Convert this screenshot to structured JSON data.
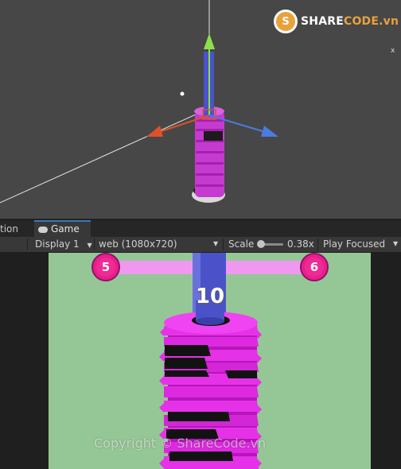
{
  "scene": {
    "brand": {
      "part1": "SHARE",
      "part2": "CODE.vn"
    },
    "axis_letter": "x"
  },
  "tabs": [
    {
      "label": "tion"
    },
    {
      "label": "Game",
      "icon": "gamepad-icon"
    }
  ],
  "toolbar": {
    "display": "Display 1",
    "resolution": "web (1080x720)",
    "scale_label": "Scale",
    "scale_value": "0.38x",
    "play_mode": "Play Focused",
    "scale_fraction": 0.05
  },
  "game": {
    "left_level": "5",
    "right_level": "6",
    "score": "10",
    "colors": {
      "background": "#95c796",
      "ring": "#e532e8",
      "ring_dark": "#b516b8",
      "danger": "#121212",
      "level_circle": "#e91e8c",
      "progress_bar": "#f098f0",
      "pole": "#4b52c9"
    }
  },
  "watermark": "Copyright © ShareCode.vn"
}
